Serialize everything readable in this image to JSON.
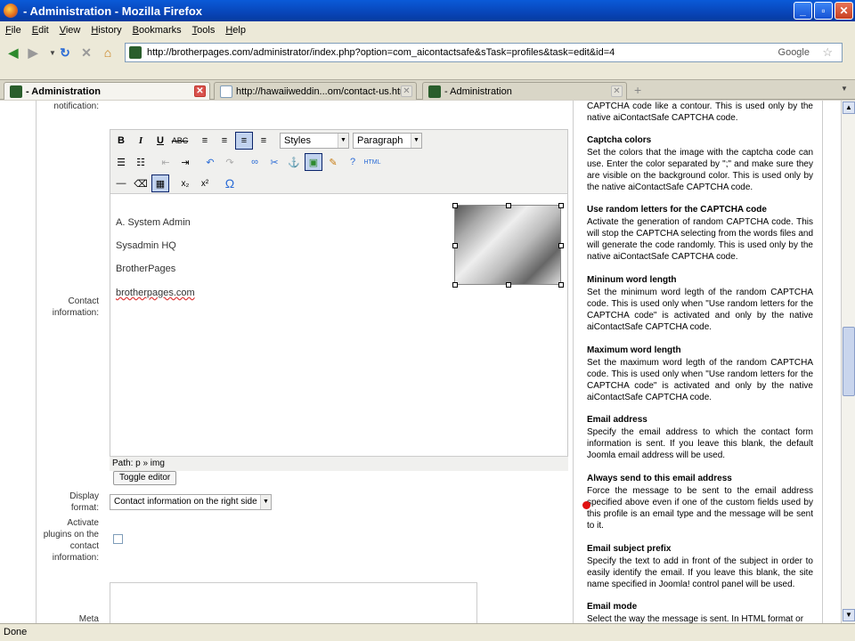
{
  "window": {
    "title": "- Administration - Mozilla Firefox"
  },
  "menu": [
    "File",
    "Edit",
    "View",
    "History",
    "Bookmarks",
    "Tools",
    "Help"
  ],
  "nav": {
    "url": "http://brotherpages.com/administrator/index.php?option=com_aicontactsafe&sTask=profiles&task=edit&id=4",
    "search_engine": "Google"
  },
  "tabs": [
    {
      "label": "- Administration"
    },
    {
      "label": "http://hawaiiweddin...om/contact-us.html"
    },
    {
      "label": "- Administration"
    }
  ],
  "form": {
    "notification_label": "notification:",
    "contact_info_label": "Contact\ninformation:",
    "display_format_label": "Display\nformat:",
    "activate_plugins_label": "Activate\nplugins on the\ncontact\ninformation:",
    "meta_label": "Meta",
    "styles_select": "Styles",
    "paragraph_select": "Paragraph",
    "editor_lines": [
      "A. System Admin",
      "Sysadmin HQ",
      "BrotherPages",
      "brotherpages.com"
    ],
    "path": "Path: p » img",
    "toggle_editor": "Toggle editor",
    "display_format_value": "Contact information on the right side"
  },
  "help": {
    "intro": "CAPTCHA code like a contour. This is used only by the native aiContactSafe CAPTCHA code.",
    "sections": [
      {
        "title": "Captcha colors",
        "text": "Set the colors that the image with the captcha code can use. Enter the color separated by \";\" and make sure they are visible on the background color. This is used only by the native aiContactSafe CAPTCHA code."
      },
      {
        "title": "Use random letters for the CAPTCHA code",
        "text": "Activate the generation of random CAPTCHA code. This will stop the CAPTCHA selecting from the words files and will generate the code randomly. This is used only by the native aiContactSafe CAPTCHA code."
      },
      {
        "title": "Mininum word length",
        "text": "Set the minimum word legth of the random CAPTCHA code. This is used only when \"Use random letters for the CAPTCHA code\" is activated and only by the native aiContactSafe CAPTCHA code."
      },
      {
        "title": "Maximum word length",
        "text": "Set the maximum word legth of the random CAPTCHA code. This is used only when \"Use random letters for the CAPTCHA code\" is activated and only by the native aiContactSafe CAPTCHA code."
      },
      {
        "title": "Email address",
        "text": "Specify the email address to which the contact form information is sent. If you leave this blank, the default Joomla email address will be used."
      },
      {
        "title": "Always send to this email address",
        "text": "Force the message to be sent to the email address specified above even if one of the custom fields used by this profile is an email type and the message will be sent to it."
      },
      {
        "title": "Email subject prefix",
        "text": "Specify the text to add in front of the subject in order to easily identify the email. If you leave this blank, the site name specified in Joomla! control panel will be used."
      },
      {
        "title": "Email mode",
        "text": "Select the way the message is sent. In HTML format or"
      }
    ]
  },
  "status": "Done"
}
